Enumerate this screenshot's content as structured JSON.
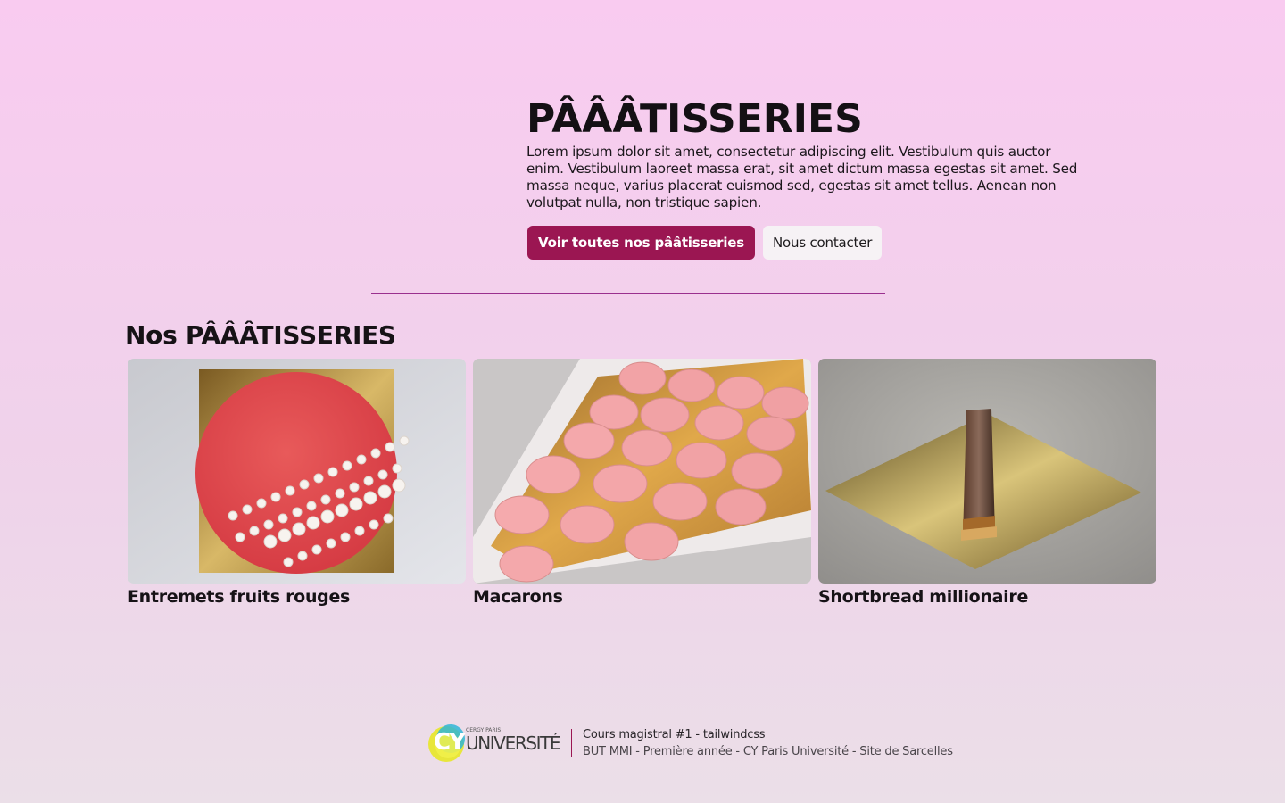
{
  "hero": {
    "title": "PÂÂÂTISSERIES",
    "text": "Lorem ipsum dolor sit amet, consectetur adipiscing elit. Vestibulum quis auctor enim. Vestibulum laoreet massa erat, sit amet dictum massa egestas sit amet. Sed massa neque, varius placerat euismod sed, egestas sit amet tellus. Aenean non volutpat nulla, non tristique sapien.",
    "primary_button": "Voir toutes nos pââtisseries",
    "secondary_button": "Nous contacter"
  },
  "section": {
    "title": "Nos PÂÂÂTISSERIES"
  },
  "cards": [
    {
      "label": "Entremets fruits rouges",
      "image": "red-entremets-cake"
    },
    {
      "label": "Macarons",
      "image": "pink-macarons-box"
    },
    {
      "label": "Shortbread millionaire",
      "image": "shortbread-bar"
    }
  ],
  "footer": {
    "logo_small": "CERGY PARIS",
    "logo_big": "UNIVERSITÉ",
    "logo_mark": "CY",
    "line1": "Cours magistral #1 - tailwindcss",
    "line2": "BUT MMI - Première année - CY Paris Université - Site de Sarcelles"
  },
  "colors": {
    "accent": "#9b1652",
    "divider": "#9a2f8e"
  }
}
